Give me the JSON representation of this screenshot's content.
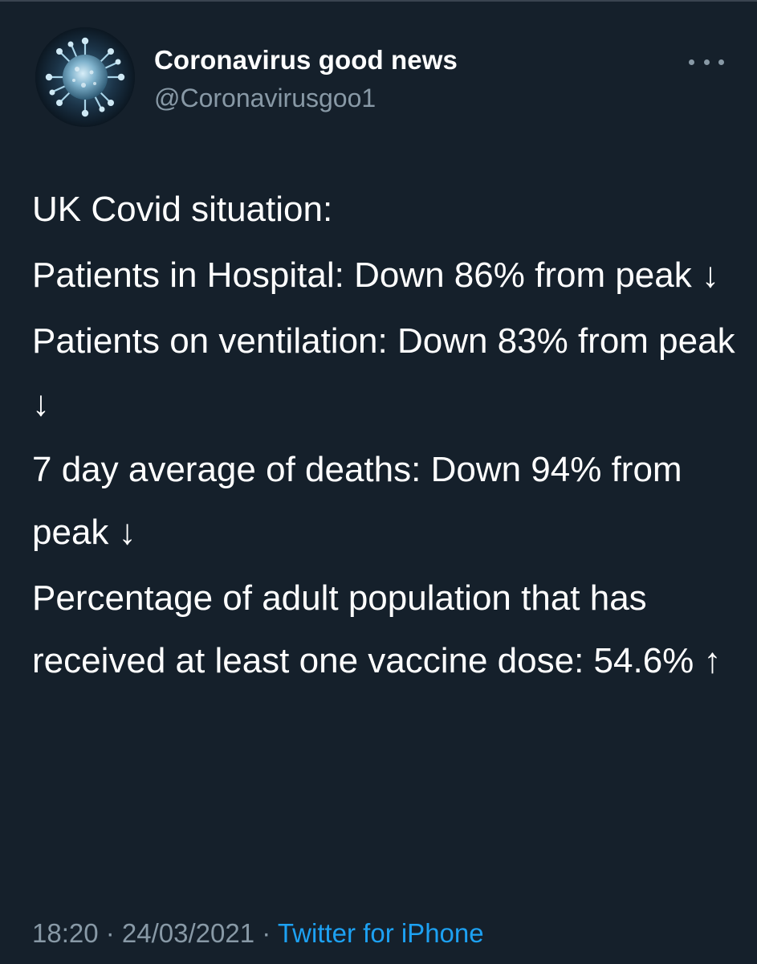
{
  "tweet": {
    "author_name": "Coronavirus good news",
    "author_handle": "@Coronavirusgoo1",
    "avatar_icon": "coronavirus-icon",
    "more_icon": "more-options-icon",
    "paragraphs": [
      "UK Covid situation:",
      "Patients in Hospital: Down 86% from peak ↓",
      "Patients on ventilation: Down 83% from peak ↓",
      "7 day average of deaths: Down 94% from peak ↓",
      "Percentage of adult population that has received at least one vaccine dose: 54.6% ↑"
    ],
    "time": "18:20",
    "separator": " · ",
    "date": "24/03/2021",
    "source": "Twitter for iPhone"
  },
  "colors": {
    "background": "#15202b",
    "text": "#ffffff",
    "secondary_text": "#8899a6",
    "link": "#1da1f2"
  }
}
